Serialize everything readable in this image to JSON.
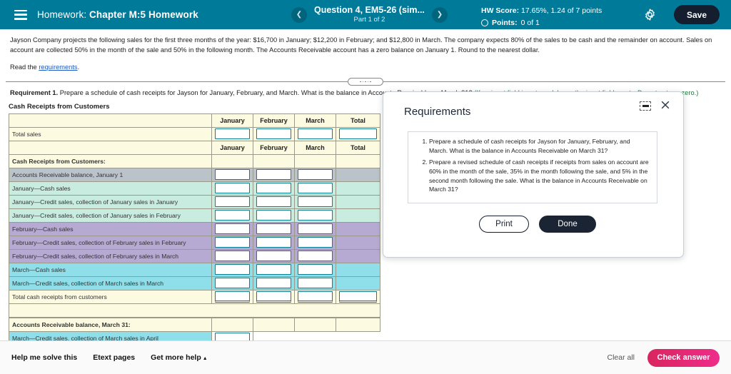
{
  "header": {
    "menu_icon": "hamburger-icon",
    "course_label": "Homework:",
    "assignment_title": "Chapter M:5 Homework",
    "prev_icon": "chevron-left-icon",
    "next_icon": "chevron-right-icon",
    "question_title": "Question 4, EM5-26 (sim...",
    "question_part": "Part 1 of 2",
    "hw_score_label": "HW Score:",
    "hw_score_value": "17.65%, 1.24 of 7 points",
    "points_label": "Points:",
    "points_value": "0 of 1",
    "settings_icon": "gear-icon",
    "save_label": "Save",
    "accent_color": "#007a99",
    "save_bg": "#141e2e"
  },
  "problem": {
    "paragraph": "Jayson Company projects the following sales for the first three months of the year: $16,700 in January; $12,200 in February; and $12,800 in March. The company expects 80% of the sales to be cash and the remainder on account. Sales on account are collected 50% in the month of the sale and 50% in the following month. The Accounts Receivable account has a zero balance on January 1. Round to the nearest dollar.",
    "read_prefix": "Read the ",
    "read_link": "requirements",
    "read_suffix": ".",
    "requirement_label": "Requirement 1.",
    "requirement_text": " Prepare a schedule of cash receipts for Jayson for January, February, and March. What is the balance in Accounts Receivable on March 31?",
    "requirement_hint": "(If an input field is not used, leave the input field empty. Do not enter a zero.)"
  },
  "worksheet": {
    "title": "Cash Receipts from Customers",
    "columns": [
      "January",
      "February",
      "March",
      "Total"
    ],
    "rows": [
      {
        "label": "",
        "style": "cream",
        "kind": "header"
      },
      {
        "label": "Total sales",
        "style": "cream",
        "kind": "inputs4"
      },
      {
        "label": "",
        "style": "cream",
        "kind": "header"
      },
      {
        "label": "Cash Receipts from Customers:",
        "style": "cream",
        "kind": "section"
      },
      {
        "label": "Accounts Receivable balance, January 1",
        "style": "gray",
        "kind": "inputs3"
      },
      {
        "label": "January—Cash sales",
        "style": "mint",
        "kind": "inputs3"
      },
      {
        "label": "January—Credit sales, collection of January sales in January",
        "style": "mint",
        "kind": "inputs3"
      },
      {
        "label": "January—Credit sales, collection of January sales in February",
        "style": "mint",
        "kind": "inputs3"
      },
      {
        "label": "February—Cash sales",
        "style": "purple",
        "kind": "inputs3"
      },
      {
        "label": "February—Credit sales, collection of February sales in February",
        "style": "purple",
        "kind": "inputs3"
      },
      {
        "label": "February—Credit sales, collection of February sales in March",
        "style": "purple",
        "kind": "inputs3"
      },
      {
        "label": "March—Cash sales",
        "style": "cyan",
        "kind": "inputs3"
      },
      {
        "label": "March—Credit sales, collection of March sales in March",
        "style": "cyan",
        "kind": "inputs3"
      },
      {
        "label": "Total cash receipts from customers",
        "style": "cream",
        "kind": "totals4"
      }
    ],
    "section2_title": "Accounts Receivable balance, March 31:",
    "section2_row": "March—Credit sales, collection of March sales in April"
  },
  "dialog": {
    "title": "Requirements",
    "minimize_icon": "minimize-icon",
    "close_icon": "close-icon",
    "items": [
      "Prepare a schedule of cash receipts for Jayson for January, February, and March. What is the balance in Accounts Receivable on March 31?",
      "Prepare a revised schedule of cash receipts if receipts from sales on account are 60% in the month of the sale, 35% in the month following the sale, and 5% in the second month following the sale. What is the balance in Accounts Receivable on March 31?"
    ],
    "print_label": "Print",
    "done_label": "Done"
  },
  "footer": {
    "help_me_solve": "Help me solve this",
    "etext_pages": "Etext pages",
    "get_more_help": "Get more help",
    "get_more_help_icon": "caret-up-icon",
    "clear_all": "Clear all",
    "check_answer": "Check answer",
    "check_color": "#e02a73"
  }
}
